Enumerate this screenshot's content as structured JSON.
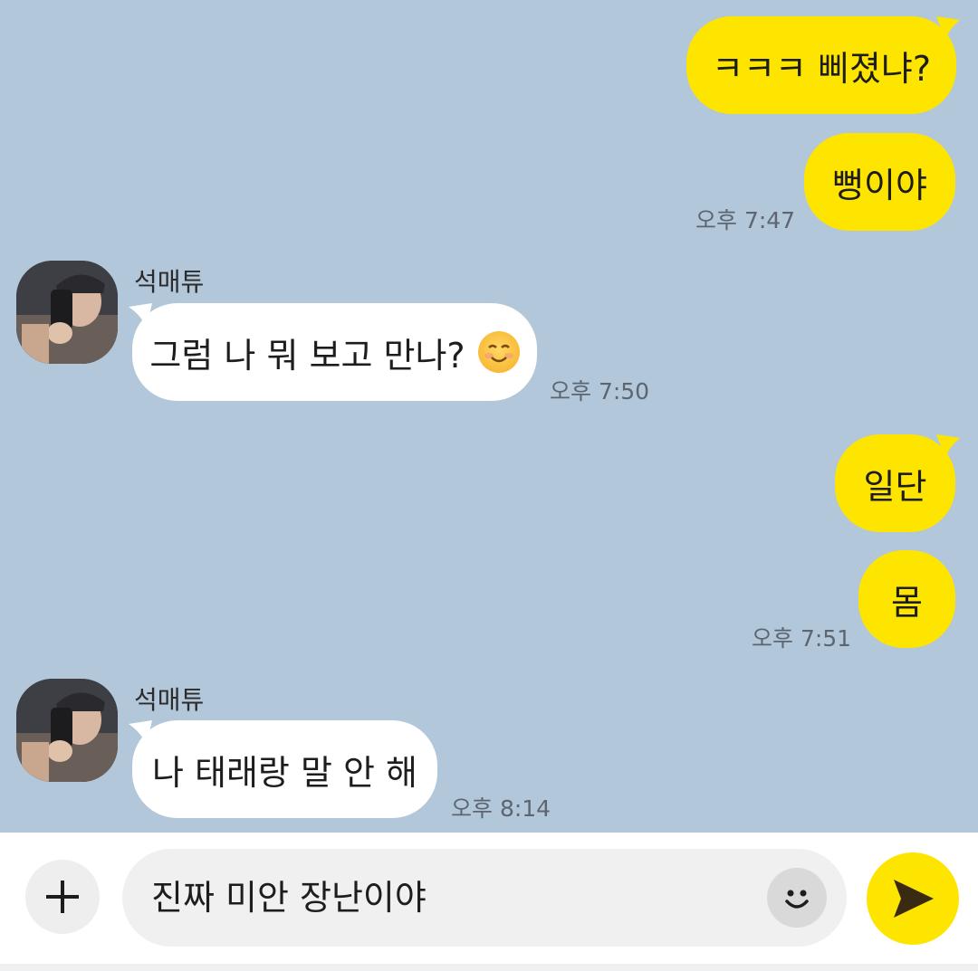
{
  "conversation": {
    "messages": [
      {
        "sender": "me",
        "text": "ㅋㅋㅋ 삐졌냐?"
      },
      {
        "sender": "me",
        "text": "뻥이야",
        "time": "오후 7:47"
      },
      {
        "sender": "석매튜",
        "text": "그럼 나 뭐 보고 만나?",
        "emoji": "smiling-face-emoji",
        "time": "오후 7:50"
      },
      {
        "sender": "me",
        "text": "일단"
      },
      {
        "sender": "me",
        "text": "몸",
        "time": "오후 7:51"
      },
      {
        "sender": "석매튜",
        "text": "나 태래랑 말 안 해",
        "time": "오후 8:14"
      }
    ],
    "contact_name": "석매튜"
  },
  "input": {
    "value": "진짜 미안 장난이야",
    "plus_icon": "plus-icon",
    "emoticon_icon": "emoticon-icon",
    "send_icon": "send-icon"
  },
  "colors": {
    "background": "#b2c7da",
    "my_bubble": "#fee500",
    "other_bubble": "#ffffff",
    "send_button": "#fee500"
  }
}
